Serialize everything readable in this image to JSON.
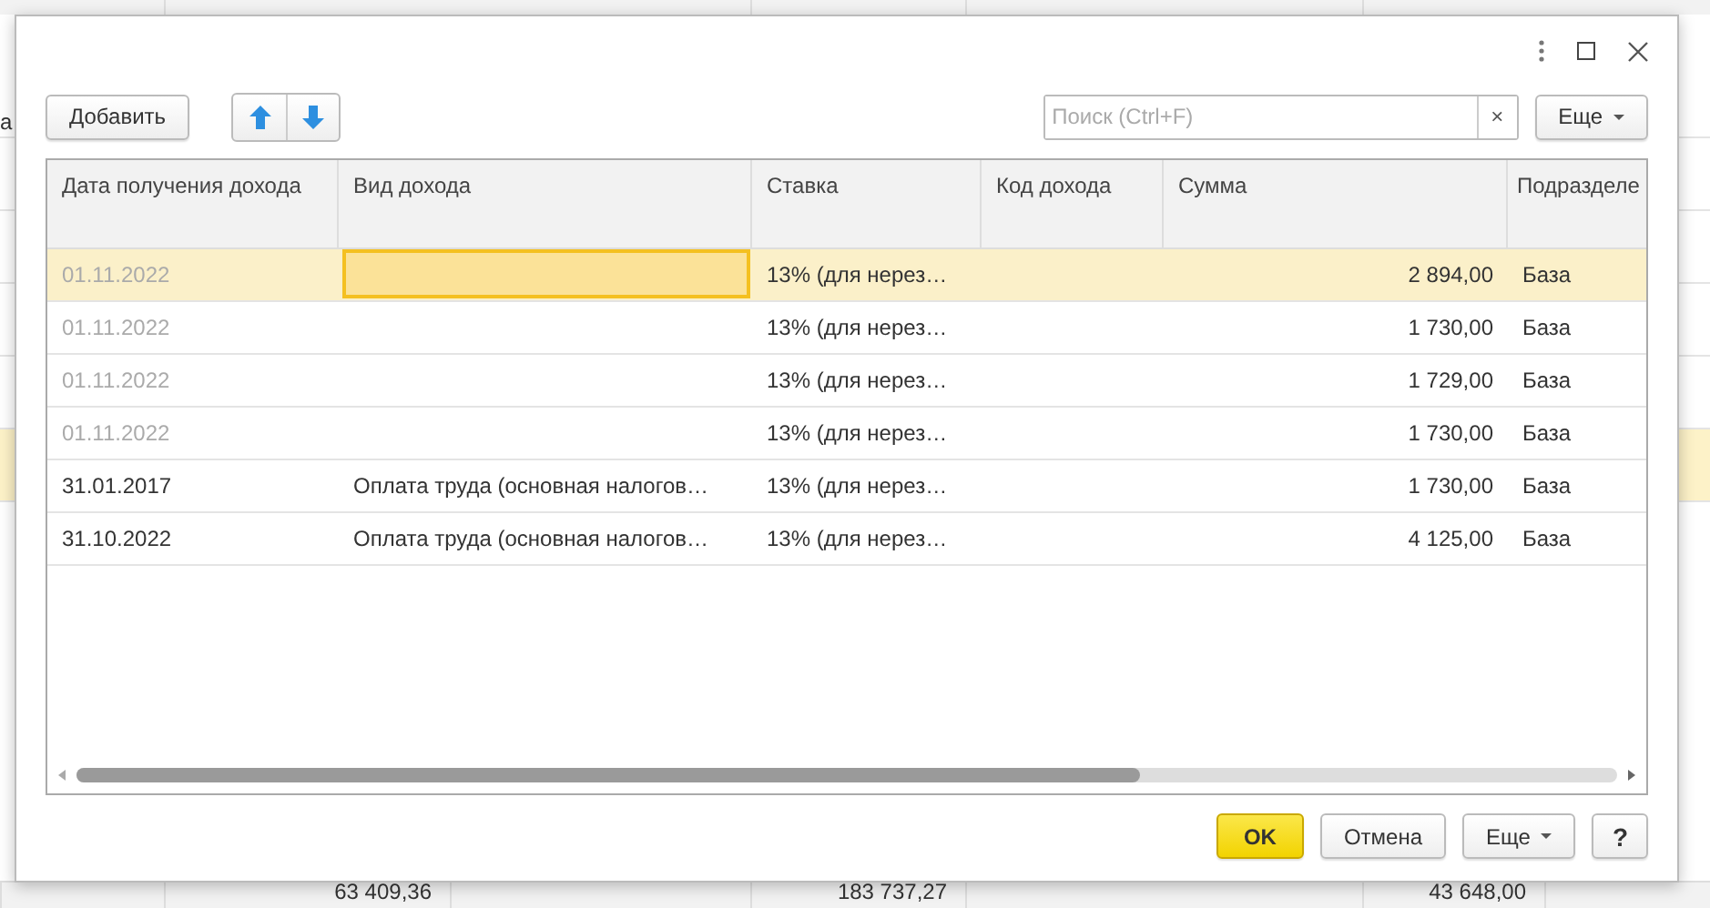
{
  "background": {
    "side_text": "а",
    "totals": [
      "63 409,36",
      "183 737,27",
      "43 648,00"
    ]
  },
  "dialog": {
    "toolbar": {
      "add_button": "Добавить",
      "search": {
        "placeholder": "Поиск (Ctrl+F)"
      },
      "clear_button": "×",
      "more_button": "Еще"
    },
    "table": {
      "columns": [
        "Дата получения дохода",
        "Вид дохода",
        "Ставка",
        "Код дохода",
        "Сумма",
        "Подразделе"
      ],
      "rows": [
        {
          "date": "01.11.2022",
          "date_dimmed": true,
          "income_type_focused": true,
          "rate": "13% (для нерез…",
          "amount": "2 894,00",
          "division": "База",
          "selected": true
        },
        {
          "date": "01.11.2022",
          "date_dimmed": true,
          "income_type_focused": false,
          "rate": "13% (для нерез…",
          "amount": "1 730,00",
          "division": "База",
          "selected": false
        },
        {
          "date": "01.11.2022",
          "date_dimmed": true,
          "income_type_focused": false,
          "rate": "13% (для нерез…",
          "amount": "1 729,00",
          "division": "База",
          "selected": false
        },
        {
          "date": "01.11.2022",
          "date_dimmed": true,
          "income_type_focused": false,
          "rate": "13% (для нерез…",
          "amount": "1 730,00",
          "division": "База",
          "selected": false
        },
        {
          "date": "31.01.2017",
          "date_dimmed": false,
          "income_type": "Оплата труда (основная налогов…",
          "income_type_focused": false,
          "rate": "13% (для нерез…",
          "amount": "1 730,00",
          "division": "База",
          "selected": false
        },
        {
          "date": "31.10.2022",
          "date_dimmed": false,
          "income_type": "Оплата труда (основная налогов…",
          "income_type_focused": false,
          "rate": "13% (для нерез…",
          "amount": "4 125,00",
          "division": "База",
          "selected": false
        }
      ]
    },
    "buttons": [
      {
        "label": "OK",
        "kind": "primary"
      },
      {
        "label": "Отмена",
        "kind": "normal"
      },
      {
        "label": "Еще",
        "kind": "menu"
      },
      {
        "label": "?",
        "kind": "help"
      }
    ]
  }
}
